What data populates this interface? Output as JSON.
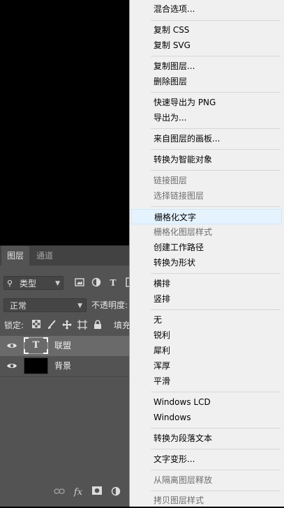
{
  "layers_panel": {
    "tabs": {
      "layers": "图层",
      "channels": "通道"
    },
    "filter": {
      "value": "类型",
      "icons": [
        "image-filter-icon",
        "adjustment-filter-icon",
        "type-filter-icon",
        "shape-filter-icon"
      ]
    },
    "blend_mode": "正常",
    "opacity_label": "不透明度:",
    "lock_label": "锁定:",
    "fill_label": "填充:",
    "layers": [
      {
        "name": "联盟",
        "kind": "text",
        "thumb_glyph": "T",
        "selected": true,
        "visible": true
      },
      {
        "name": "背景",
        "kind": "fill",
        "thumb_color": "#000000",
        "selected": false,
        "visible": true
      }
    ],
    "bottom_icons": [
      "link-icon",
      "fx-icon",
      "mask-icon",
      "adjustment-icon"
    ],
    "fx_label": "fx"
  },
  "context_menu": {
    "items": [
      {
        "label": "混合选项...",
        "enabled": true
      },
      {
        "label": "复制 CSS",
        "enabled": true
      },
      {
        "label": "复制 SVG",
        "enabled": true
      },
      {
        "label": "复制图层...",
        "enabled": true
      },
      {
        "label": "删除图层",
        "enabled": true
      },
      {
        "label": "快速导出为 PNG",
        "enabled": true
      },
      {
        "label": "导出为...",
        "enabled": true
      },
      {
        "label": "来自图层的画板...",
        "enabled": true
      },
      {
        "label": "转换为智能对象",
        "enabled": true
      },
      {
        "label": "链接图层",
        "enabled": false
      },
      {
        "label": "选择链接图层",
        "enabled": false
      },
      {
        "label": "栅格化文字",
        "enabled": true,
        "highlighted": true
      },
      {
        "label": "栅格化图层样式",
        "enabled": false
      },
      {
        "label": "创建工作路径",
        "enabled": true
      },
      {
        "label": "转换为形状",
        "enabled": true
      },
      {
        "label": "横排",
        "enabled": true
      },
      {
        "label": "竖排",
        "enabled": true
      },
      {
        "label": "无",
        "enabled": true
      },
      {
        "label": "锐利",
        "enabled": true
      },
      {
        "label": "犀利",
        "enabled": true
      },
      {
        "label": "浑厚",
        "enabled": true
      },
      {
        "label": "平滑",
        "enabled": true
      },
      {
        "label": "Windows LCD",
        "enabled": true
      },
      {
        "label": "Windows",
        "enabled": true
      },
      {
        "label": "转换为段落文本",
        "enabled": true
      },
      {
        "label": "文字变形...",
        "enabled": true
      },
      {
        "label": "从隔离图层释放",
        "enabled": false
      },
      {
        "label": "拷贝图层样式",
        "enabled": false
      }
    ]
  },
  "colors": {
    "canvas": "#000000",
    "panel": "#535353",
    "selected_layer": "#6a6a6a",
    "menu_bg": "#f0f0f0",
    "menu_highlight": "#e5f3ff",
    "disabled_text": "#6d6d6d"
  }
}
